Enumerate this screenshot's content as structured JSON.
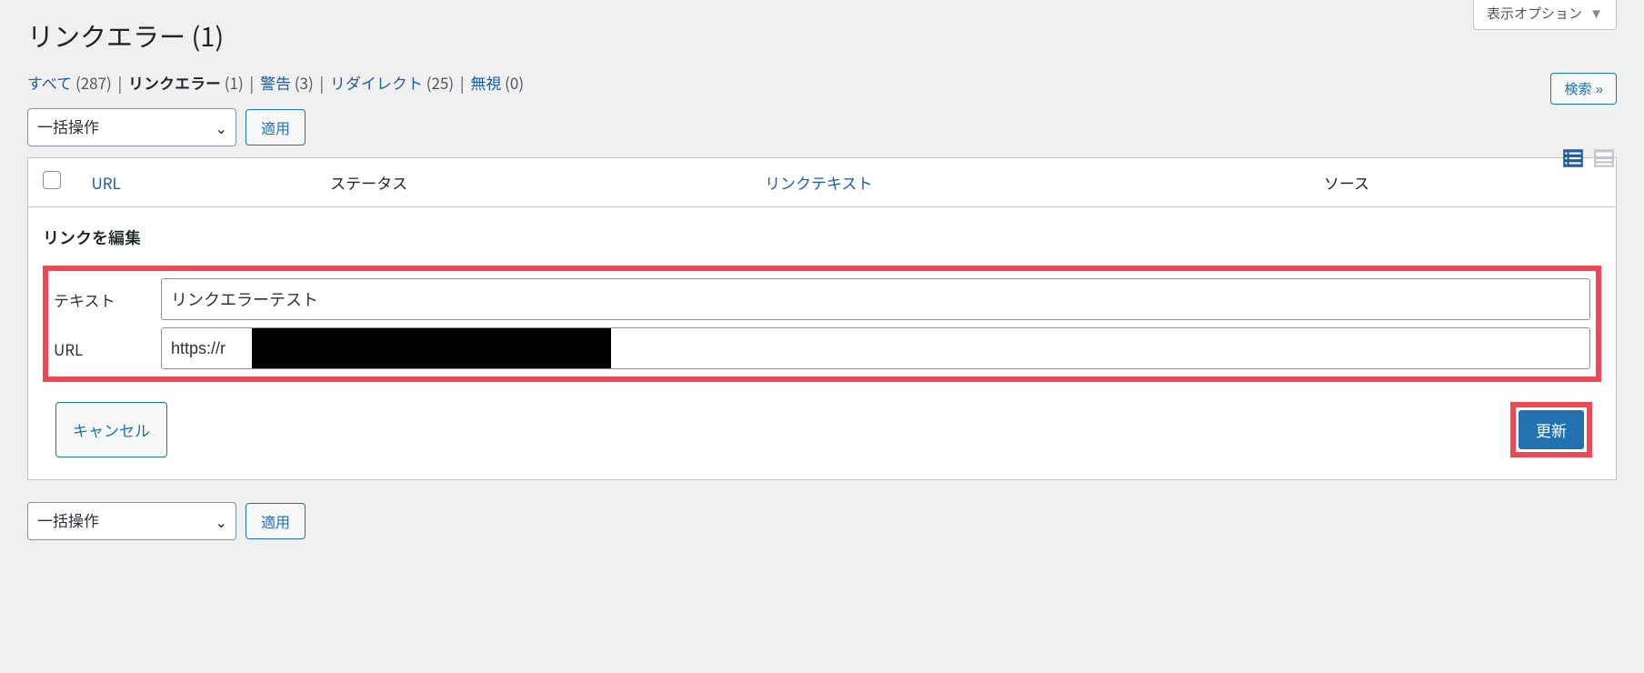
{
  "screen_options": {
    "label": "表示オプション"
  },
  "page_title": "リンクエラー (1)",
  "subnav": {
    "items": [
      {
        "label": "すべて",
        "count": "(287)",
        "current": false
      },
      {
        "label": "リンクエラー",
        "count": "(1)",
        "current": true
      },
      {
        "label": "警告",
        "count": "(3)",
        "current": false
      },
      {
        "label": "リダイレクト",
        "count": "(25)",
        "current": false
      },
      {
        "label": "無視",
        "count": "(0)",
        "current": false
      }
    ]
  },
  "search_button": "検索 »",
  "bulk": {
    "select_label": "一括操作",
    "apply_label": "適用"
  },
  "table": {
    "headers": {
      "url": "URL",
      "status": "ステータス",
      "linktext": "リンクテキスト",
      "source": "ソース"
    }
  },
  "edit_panel": {
    "heading": "リンクを編集",
    "text_label": "テキスト",
    "text_value": "リンクエラーテスト",
    "url_label": "URL",
    "url_value": "https://r",
    "cancel_label": "キャンセル",
    "update_label": "更新"
  }
}
